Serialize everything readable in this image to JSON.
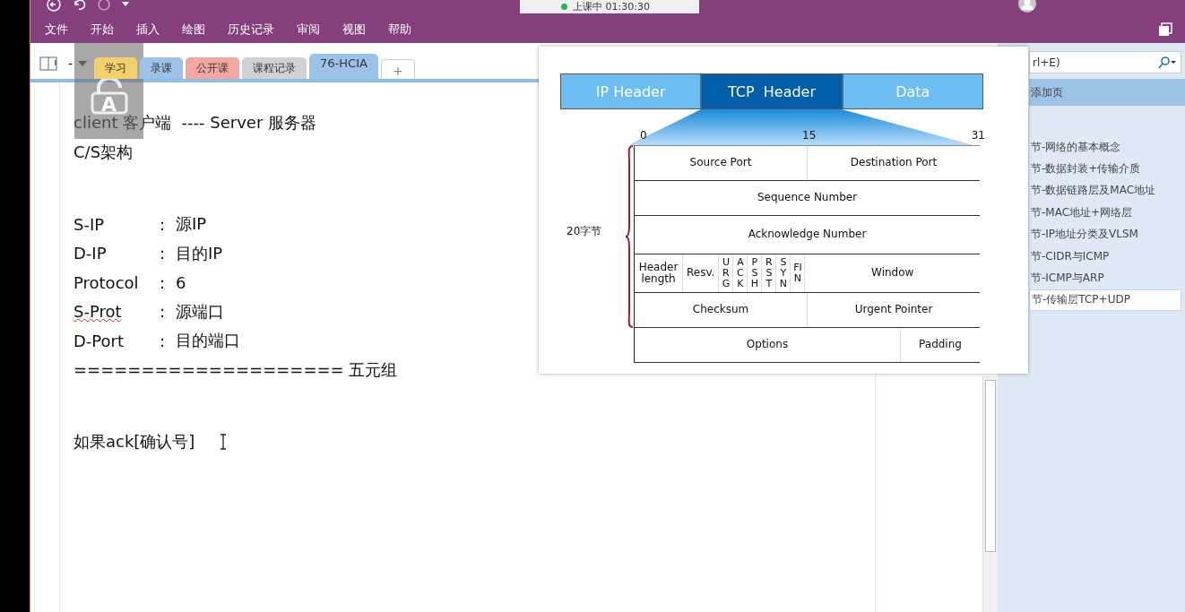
{
  "title_bar": {
    "timer": "上课中 01:30:30"
  },
  "menu": [
    "文件",
    "开始",
    "插入",
    "绘图",
    "历史记录",
    "审阅",
    "视图",
    "帮助"
  ],
  "notebook": {
    "name": "-"
  },
  "section_tabs": [
    {
      "label": "学习",
      "color": "#f3d06e",
      "selected": false
    },
    {
      "label": "录课",
      "color": "#9cc2ea",
      "selected": false
    },
    {
      "label": "公开课",
      "color": "#f3a7a2",
      "selected": false
    },
    {
      "label": "课程记录",
      "color": "#cfd1d4",
      "selected": false
    },
    {
      "label": "76-HCIA",
      "color": "#9cc2ea",
      "selected": true
    }
  ],
  "add_tab": "+",
  "lock_overlay": {
    "glyph": "A"
  },
  "note": {
    "lines": [
      {
        "kind": "text",
        "text": "client 客户端  ---- Server 服务器"
      },
      {
        "kind": "text",
        "text": "C/S架构"
      },
      {
        "kind": "gap"
      },
      {
        "kind": "field",
        "label": "S-IP",
        "sep": ":",
        "value": "源IP",
        "misspelled": false
      },
      {
        "kind": "field",
        "label": "D-IP",
        "sep": ":",
        "value": "目的IP",
        "misspelled": false
      },
      {
        "kind": "field",
        "label": "Protocol",
        "sep": ":",
        "value": "6",
        "misspelled": false
      },
      {
        "kind": "field",
        "label": "S-Prot",
        "sep": ":",
        "value": "源端口",
        "misspelled": true
      },
      {
        "kind": "field",
        "label": "D-Port",
        "sep": ":",
        "value": "目的端口",
        "misspelled": false
      },
      {
        "kind": "text",
        "text": "==================== 五元组"
      },
      {
        "kind": "gap"
      },
      {
        "kind": "text",
        "text": "如果ack[确认号]",
        "cursor": true
      }
    ]
  },
  "diagram": {
    "packet": [
      {
        "label": "IP Header",
        "selected": false
      },
      {
        "label": "TCP  Header",
        "selected": true
      },
      {
        "label": "Data",
        "selected": false
      }
    ],
    "bit_marks": [
      "0",
      "15",
      "31"
    ],
    "brace_label": "20字节",
    "rows": [
      [
        {
          "label": "Source Port",
          "kind": "half"
        },
        {
          "label": "Destination Port",
          "kind": "half"
        }
      ],
      [
        {
          "label": "Sequence Number",
          "kind": "fill"
        }
      ],
      [
        {
          "label": "Acknowledge Number",
          "kind": "fill"
        }
      ],
      [
        {
          "label": "Header length",
          "kind": "fit"
        },
        {
          "label": "Resv.",
          "kind": "fit"
        },
        {
          "label": "URG",
          "kind": "flag"
        },
        {
          "label": "ACK",
          "kind": "flag"
        },
        {
          "label": "PSH",
          "kind": "flag"
        },
        {
          "label": "RST",
          "kind": "flag"
        },
        {
          "label": "SYN",
          "kind": "flag"
        },
        {
          "label": "FIN",
          "kind": "flag"
        },
        {
          "label": "Window",
          "kind": "fill"
        }
      ],
      [
        {
          "label": "Checksum",
          "kind": "half"
        },
        {
          "label": "Urgent Pointer",
          "kind": "half"
        }
      ],
      [
        {
          "label": "Options",
          "kind": "fill"
        },
        {
          "label": "Padding",
          "kind": "fit"
        }
      ]
    ]
  },
  "sidebar": {
    "search_placeholder": "rl+E)",
    "add_page": "添加页",
    "pages": [
      {
        "title": "节-网络的基本概念",
        "selected": false
      },
      {
        "title": "节-数据封装+传输介质",
        "selected": false
      },
      {
        "title": "节-数据链路层及MAC地址",
        "selected": false
      },
      {
        "title": "节-MAC地址+网络层",
        "selected": false
      },
      {
        "title": "节-IP地址分类及VLSM",
        "selected": false
      },
      {
        "title": "节-CIDR与ICMP",
        "selected": false
      },
      {
        "title": "节-ICMP与ARP",
        "selected": false
      },
      {
        "title": "节-传输层TCP+UDP",
        "selected": true
      }
    ]
  }
}
